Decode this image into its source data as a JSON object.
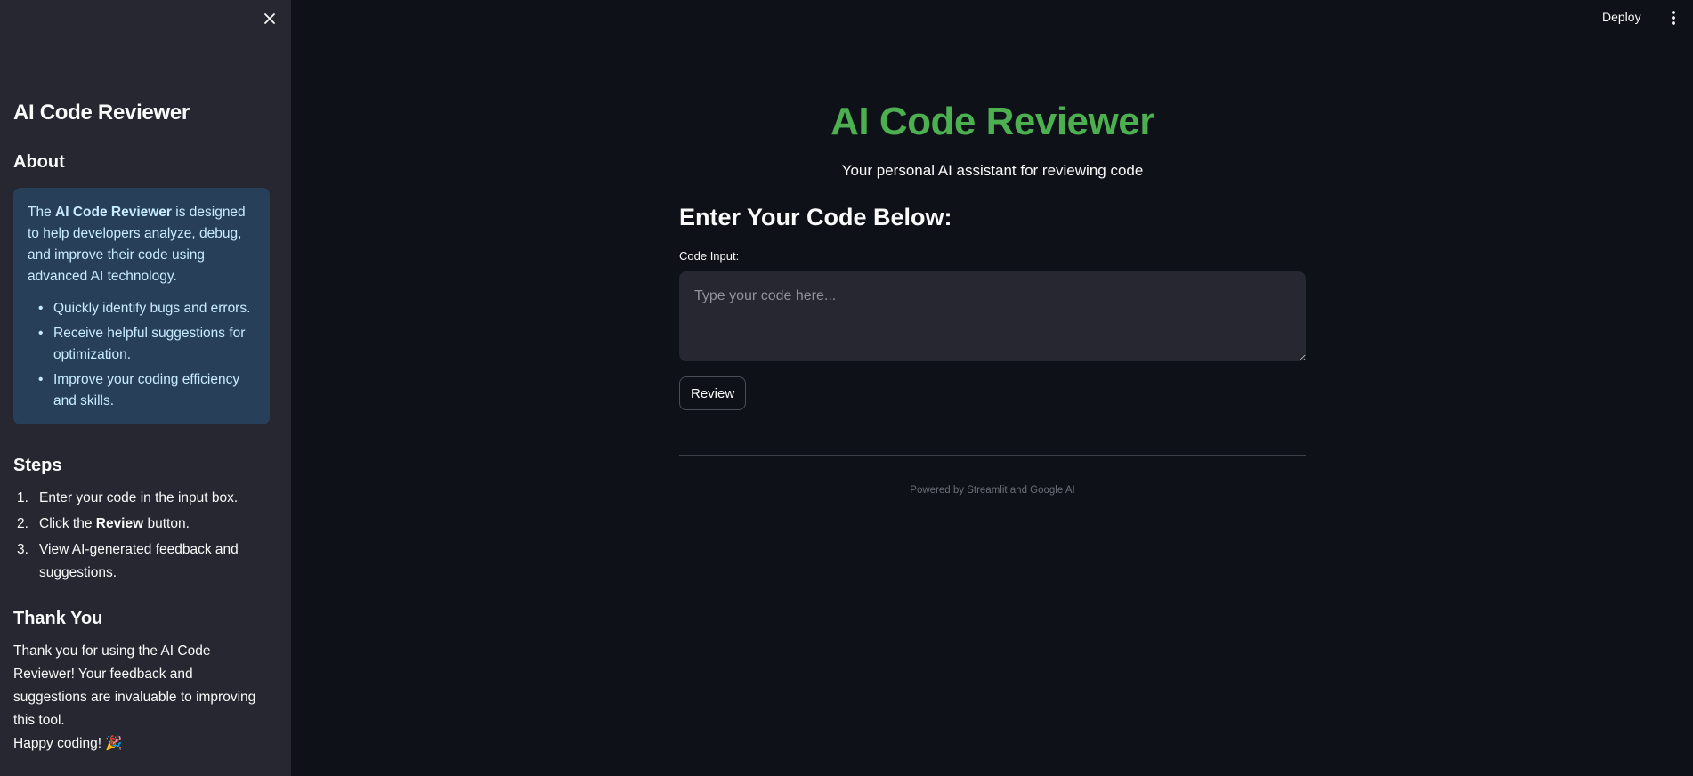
{
  "sidebar": {
    "title": "AI Code Reviewer",
    "about": {
      "heading": "About",
      "intro_pre": "The ",
      "intro_bold": "AI Code Reviewer",
      "intro_post": " is designed to help developers analyze, debug, and improve their code using advanced AI technology.",
      "bullets": [
        "Quickly identify bugs and errors.",
        "Receive helpful suggestions for optimization.",
        "Improve your coding efficiency and skills."
      ]
    },
    "steps": {
      "heading": "Steps",
      "items": [
        {
          "num": "1.",
          "pre": "Enter your code in the input box.",
          "bold": "",
          "post": ""
        },
        {
          "num": "2.",
          "pre": "Click the ",
          "bold": "Review",
          "post": " button."
        },
        {
          "num": "3.",
          "pre": "View AI-generated feedback and suggestions.",
          "bold": "",
          "post": ""
        }
      ]
    },
    "thanks": {
      "heading": "Thank You",
      "line1": "Thank you for using the AI Code Reviewer! Your feedback and suggestions are invaluable to improving this tool.",
      "line2": "Happy coding! 🎉"
    }
  },
  "header": {
    "deploy_label": "Deploy"
  },
  "main": {
    "title": "AI Code Reviewer",
    "subtitle": "Your personal AI assistant for reviewing code",
    "section_heading": "Enter Your Code Below:",
    "code_label": "Code Input:",
    "code_placeholder": "Type your code here...",
    "code_value": "",
    "review_label": "Review",
    "footer": "Powered by Streamlit and Google AI"
  },
  "colors": {
    "title_green": "#4caf50",
    "sidebar_bg": "#262730",
    "page_bg": "#0e1117",
    "info_bg": "#283f5a",
    "info_text": "#c7ebff"
  },
  "icons": {
    "close": "close-icon",
    "menu": "kebab-menu-icon"
  }
}
